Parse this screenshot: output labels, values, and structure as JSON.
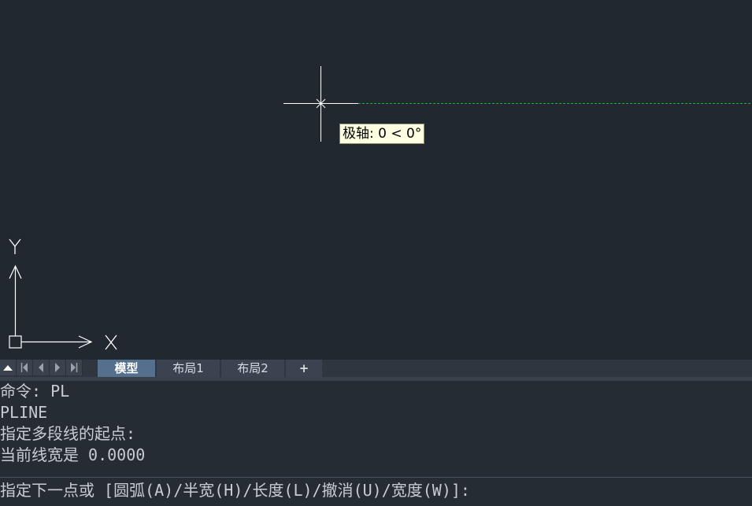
{
  "canvas": {
    "tooltip": "极轴: 0 < 0°",
    "ucs": {
      "x_label": "X",
      "y_label": "Y"
    },
    "colors": {
      "background": "#212830",
      "crosshair": "#ffffff",
      "polar_track": "#1fae3a",
      "rubber_band": "#d040d0"
    }
  },
  "tabs": {
    "nav_icons": [
      "triangle-up-icon",
      "first-icon",
      "prev-icon",
      "next-icon",
      "last-icon"
    ],
    "items": [
      {
        "label": "模型",
        "active": true
      },
      {
        "label": "布局1",
        "active": false
      },
      {
        "label": "布局2",
        "active": false
      }
    ],
    "add_label": "+"
  },
  "command": {
    "history": [
      "命令: PL",
      "PLINE",
      "指定多段线的起点:",
      "当前线宽是 0.0000"
    ],
    "prompt": "指定下一点或 [圆弧(A)/半宽(H)/长度(L)/撤消(U)/宽度(W)]:"
  }
}
